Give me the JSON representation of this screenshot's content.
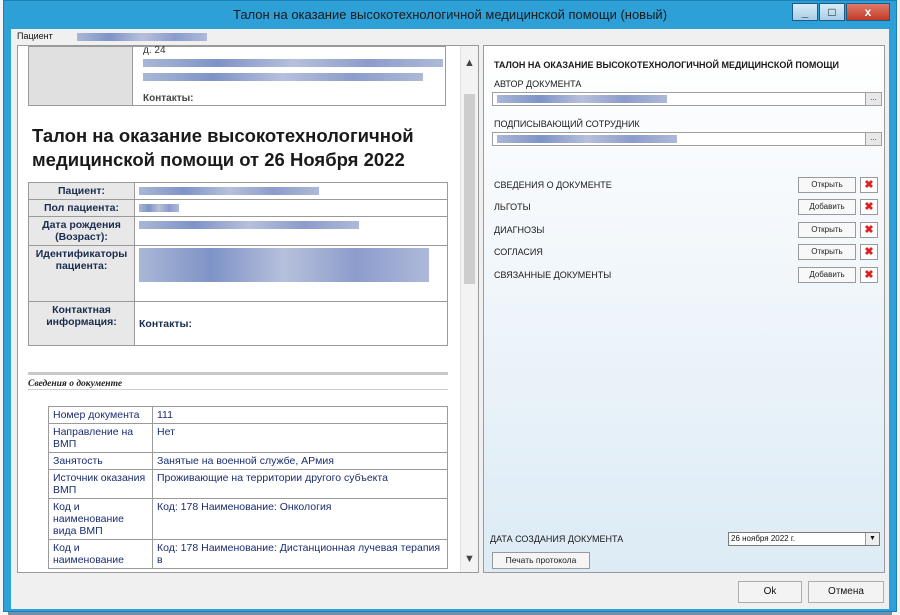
{
  "window": {
    "title": "Талон на оказание высокотехнологичной медицинской помощи (новый)",
    "minimize": "_",
    "maximize": "□",
    "close": "x"
  },
  "patient_bar": {
    "label": "Пациент"
  },
  "document": {
    "top_box": {
      "line1": "д. 24",
      "contacts_line": "Контакты:"
    },
    "title": "Талон на оказание высокотехнологичной медицинской помощи от 26 Ноября 2022",
    "patient_table": [
      {
        "label": "Пациент:",
        "value": ""
      },
      {
        "label": "Пол пациента:",
        "value": ""
      },
      {
        "label": "Дата рождения (Возраст):",
        "value": ""
      },
      {
        "label": "Идентификаторы пациента:",
        "value": ""
      },
      {
        "label": "Контактная информация:",
        "value": "Контакты:"
      }
    ],
    "section_header": "Сведения о документе",
    "details_table": [
      {
        "key": "Номер документа",
        "value": "111"
      },
      {
        "key": "Направление на ВМП",
        "value": "Нет"
      },
      {
        "key": "Занятость",
        "value": "Занятые на военной службе, АРмия"
      },
      {
        "key": "Источник оказания ВМП",
        "value": "Проживающие на территории другого субъекта"
      },
      {
        "key": "Код и наименование вида ВМП",
        "value": "Код: 178 Наименование: Онкология"
      },
      {
        "key": "Код и наименование",
        "value": "Код: 178 Наименование: Дистанционная лучевая терапия в"
      }
    ]
  },
  "right_panel": {
    "title": "ТАЛОН НА ОКАЗАНИЕ ВЫСОКОТЕХНОЛОГИЧНОЙ МЕДИЦИНСКОЙ ПОМОЩИ",
    "author_label": "АВТОР ДОКУМЕНТА",
    "signer_label": "ПОДПИСЫВАЮЩИЙ СОТРУДНИК",
    "ellipsis": "...",
    "sections": [
      {
        "name": "СВЕДЕНИЯ О ДОКУМЕНТЕ",
        "action": "Открыть"
      },
      {
        "name": "ЛЬГОТЫ",
        "action": "Добавить"
      },
      {
        "name": "ДИАГНОЗЫ",
        "action": "Открыть"
      },
      {
        "name": "СОГЛАСИЯ",
        "action": "Открыть"
      },
      {
        "name": "СВЯЗАННЫЕ ДОКУМЕНТЫ",
        "action": "Добавить"
      }
    ],
    "delete_glyph": "✖",
    "date_label": "ДАТА СОЗДАНИЯ ДОКУМЕНТА",
    "date_value": "26  ноября  2022 г.",
    "print_button": "Печать протокола"
  },
  "buttons": {
    "ok": "Ok",
    "cancel": "Отмена"
  },
  "colors": {
    "title_bar": "#2ea0d8",
    "close_button": "#c33a25",
    "link_text": "#1a2d70"
  },
  "icons": {
    "delete": "delete-icon",
    "scroll_up": "chevron-up-icon",
    "scroll_down": "chevron-down-icon"
  }
}
